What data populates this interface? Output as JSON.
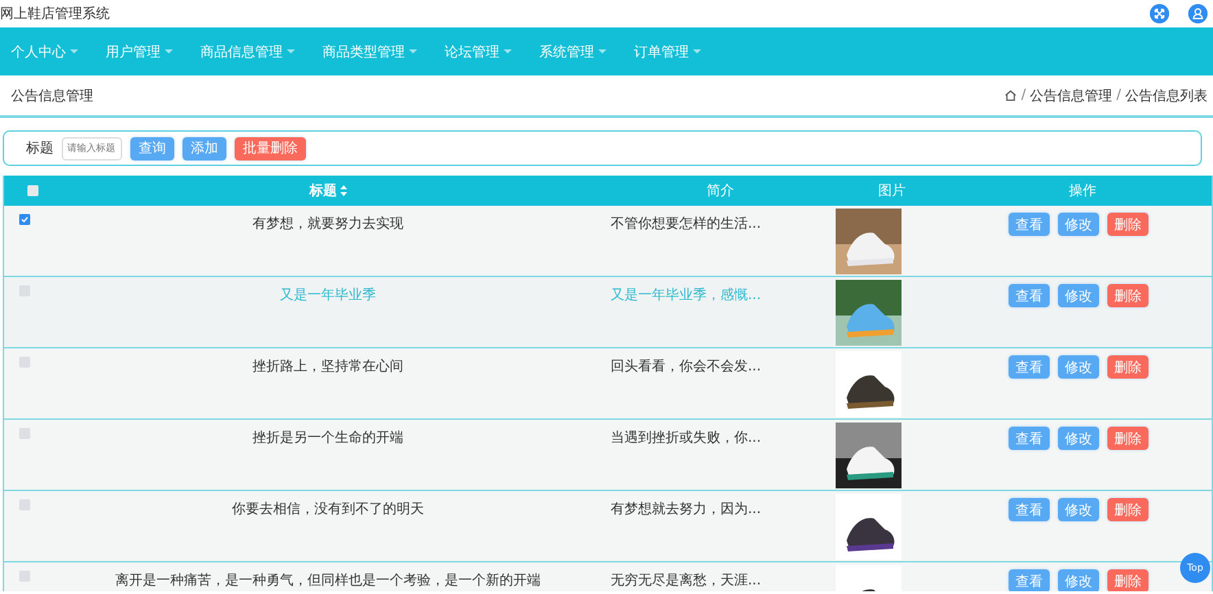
{
  "app": {
    "title": "网上鞋店管理系统"
  },
  "nav": [
    {
      "label": "个人中心"
    },
    {
      "label": "用户管理"
    },
    {
      "label": "商品信息管理"
    },
    {
      "label": "商品类型管理"
    },
    {
      "label": "论坛管理"
    },
    {
      "label": "系统管理"
    },
    {
      "label": "订单管理"
    }
  ],
  "page_title": "公告信息管理",
  "breadcrumb": [
    {
      "kind": "separator",
      "text": "/"
    },
    {
      "kind": "link",
      "text": "公告信息管理"
    },
    {
      "kind": "separator",
      "text": "/"
    },
    {
      "kind": "link",
      "text": "公告信息列表"
    }
  ],
  "search": {
    "label": "标题",
    "placeholder": "请输入标题",
    "buttons": [
      {
        "label": "查询",
        "kind": "primary"
      },
      {
        "label": "添加",
        "kind": "primary"
      },
      {
        "label": "批量删除",
        "kind": "danger"
      }
    ]
  },
  "table": {
    "all_checked": false,
    "columns": [
      {
        "label": "标题",
        "sortable": true
      },
      {
        "label": "简介",
        "sortable": false
      },
      {
        "label": "图片",
        "sortable": false
      },
      {
        "label": "操作",
        "sortable": false
      }
    ],
    "rows": [
      {
        "title": "有梦想，就要努力去实现",
        "intro": "不管你想要怎样的生活...",
        "checked": true,
        "hovered": false,
        "actions": [
          {
            "label": "查看",
            "kind": "primary"
          },
          {
            "label": "修改",
            "kind": "primary"
          },
          {
            "label": "删除",
            "kind": "danger"
          }
        ]
      },
      {
        "title": "又是一年毕业季",
        "intro": "又是一年毕业季，感慨...",
        "checked": false,
        "hovered": true,
        "actions": [
          {
            "label": "查看",
            "kind": "primary"
          },
          {
            "label": "修改",
            "kind": "primary"
          },
          {
            "label": "删除",
            "kind": "danger"
          }
        ]
      },
      {
        "title": "挫折路上，坚持常在心间",
        "intro": "回头看看，你会不会发...",
        "checked": false,
        "hovered": false,
        "actions": [
          {
            "label": "查看",
            "kind": "primary"
          },
          {
            "label": "修改",
            "kind": "primary"
          },
          {
            "label": "删除",
            "kind": "danger"
          }
        ]
      },
      {
        "title": "挫折是另一个生命的开端",
        "intro": "当遇到挫折或失败，你...",
        "checked": false,
        "hovered": false,
        "actions": [
          {
            "label": "查看",
            "kind": "primary"
          },
          {
            "label": "修改",
            "kind": "primary"
          },
          {
            "label": "删除",
            "kind": "danger"
          }
        ]
      },
      {
        "title": "你要去相信，没有到不了的明天",
        "intro": "有梦想就去努力，因为...",
        "checked": false,
        "hovered": false,
        "actions": [
          {
            "label": "查看",
            "kind": "primary"
          },
          {
            "label": "修改",
            "kind": "primary"
          },
          {
            "label": "删除",
            "kind": "danger"
          }
        ]
      },
      {
        "title": "离开是一种痛苦，是一种勇气，但同样也是一个考验，是一个新的开端",
        "intro": "无穷无尽是离愁，天涯...",
        "checked": false,
        "hovered": false,
        "actions": [
          {
            "label": "查看",
            "kind": "primary"
          },
          {
            "label": "修改",
            "kind": "primary"
          },
          {
            "label": "删除",
            "kind": "danger"
          }
        ]
      }
    ]
  },
  "back_to_top": "Top"
}
